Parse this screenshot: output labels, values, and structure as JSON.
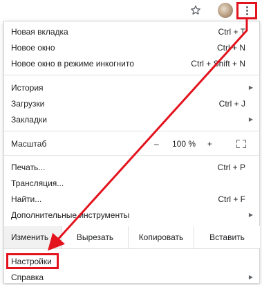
{
  "toolbar": {
    "star_icon": "star-outline-icon",
    "avatar": "profile-avatar",
    "menu_icon": "kebab-menu-icon"
  },
  "menu": {
    "new_tab": {
      "label": "Новая вкладка",
      "shortcut": "Ctrl + T"
    },
    "new_window": {
      "label": "Новое окно",
      "shortcut": "Ctrl + N"
    },
    "incognito": {
      "label": "Новое окно в режиме инкогнито",
      "shortcut": "Ctrl + Shift + N"
    },
    "history": {
      "label": "История"
    },
    "downloads": {
      "label": "Загрузки",
      "shortcut": "Ctrl + J"
    },
    "bookmarks": {
      "label": "Закладки"
    },
    "zoom": {
      "label": "Масштаб",
      "minus": "–",
      "value": "100 %",
      "plus": "+"
    },
    "print": {
      "label": "Печать...",
      "shortcut": "Ctrl + P"
    },
    "cast": {
      "label": "Трансляция..."
    },
    "find": {
      "label": "Найти...",
      "shortcut": "Ctrl + F"
    },
    "more_tools": {
      "label": "Дополнительные инструменты"
    },
    "edit": {
      "label": "Изменить",
      "cut": "Вырезать",
      "copy": "Копировать",
      "paste": "Вставить"
    },
    "settings": {
      "label": "Настройки"
    },
    "help": {
      "label": "Справка"
    }
  },
  "annotation": {
    "color": "#e3131e"
  }
}
